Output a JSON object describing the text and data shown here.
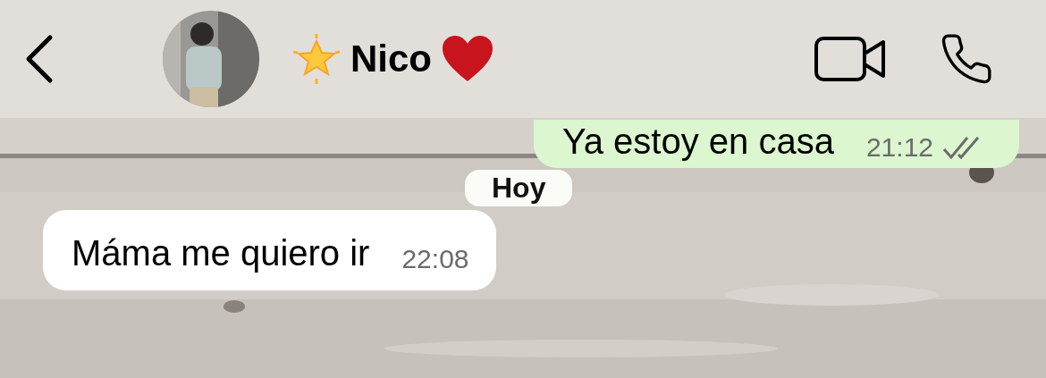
{
  "header": {
    "contact_name": "Nico"
  },
  "messages": [
    {
      "kind": "sent",
      "text": "Ya estoy en casa",
      "time": "21:12",
      "read": false
    },
    {
      "kind": "date",
      "text": "Hoy"
    },
    {
      "kind": "received",
      "text": "Máma me quiero ir",
      "time": "22:08"
    }
  ]
}
